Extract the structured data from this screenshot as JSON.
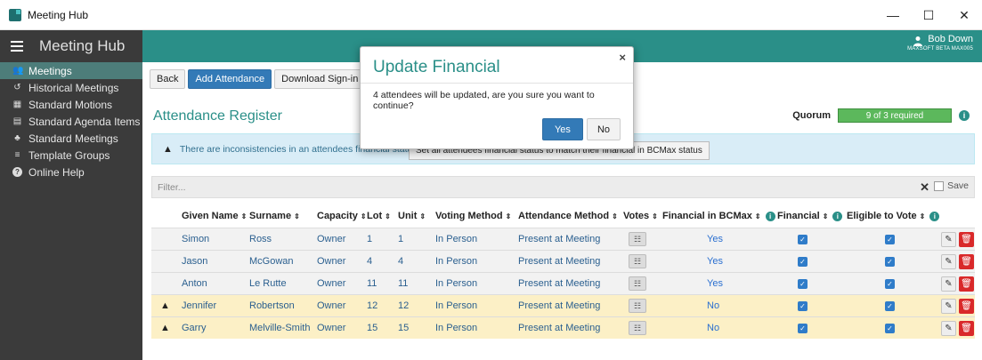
{
  "window": {
    "title": "Meeting Hub",
    "minimize": "—",
    "maximize": "☐",
    "close": "✕"
  },
  "header": {
    "brand": "Meeting Hub",
    "user_name": "Bob Down",
    "user_sub": "MAXSOFT BETA MAX005"
  },
  "sidebar": {
    "items": [
      {
        "label": "Meetings",
        "icon": "👥",
        "active": true
      },
      {
        "label": "Historical Meetings",
        "icon": "↺"
      },
      {
        "label": "Standard Motions",
        "icon": "▦"
      },
      {
        "label": "Standard Agenda Items",
        "icon": "▤"
      },
      {
        "label": "Standard Meetings",
        "icon": "♣"
      },
      {
        "label": "Template Groups",
        "icon": "≡"
      },
      {
        "label": "Online Help",
        "icon": "?"
      }
    ]
  },
  "toolbar": {
    "back": "Back",
    "add_attendance": "Add Attendance",
    "download_sign_in": "Download Sign-in Sheet"
  },
  "page": {
    "title": "Attendance Register",
    "quorum_label": "Quorum",
    "quorum_value": "9 of 3 required"
  },
  "alert": {
    "text": "There are inconsistencies in an attendees financial status",
    "button": "Set all attendees financial status to match their financial in BCMax status"
  },
  "filter": {
    "placeholder": "Filter...",
    "clear": "✕",
    "save_label": "Save"
  },
  "table": {
    "headers": {
      "given": "Given Name",
      "surname": "Surname",
      "capacity": "Capacity",
      "lot": "Lot",
      "unit": "Unit",
      "voting_method": "Voting Method",
      "attendance_method": "Attendance Method",
      "votes": "Votes",
      "financial_bcmax": "Financial in BCMax",
      "financial": "Financial",
      "eligible": "Eligible to Vote"
    },
    "sort_icon": "⇕",
    "rows": [
      {
        "warn": false,
        "given": "Simon",
        "surname": "Ross",
        "capacity": "Owner",
        "lot": "1",
        "unit": "1",
        "voting_method": "In Person",
        "attendance_method": "Present at Meeting",
        "financial_bcmax": "Yes",
        "financial": true,
        "eligible": true
      },
      {
        "warn": false,
        "given": "Jason",
        "surname": "McGowan",
        "capacity": "Owner",
        "lot": "4",
        "unit": "4",
        "voting_method": "In Person",
        "attendance_method": "Present at Meeting",
        "financial_bcmax": "Yes",
        "financial": true,
        "eligible": true
      },
      {
        "warn": false,
        "given": "Anton",
        "surname": "Le Rutte",
        "capacity": "Owner",
        "lot": "11",
        "unit": "11",
        "voting_method": "In Person",
        "attendance_method": "Present at Meeting",
        "financial_bcmax": "Yes",
        "financial": true,
        "eligible": true
      },
      {
        "warn": true,
        "given": "Jennifer",
        "surname": "Robertson",
        "capacity": "Owner",
        "lot": "12",
        "unit": "12",
        "voting_method": "In Person",
        "attendance_method": "Present at Meeting",
        "financial_bcmax": "No",
        "financial": true,
        "eligible": true
      },
      {
        "warn": true,
        "given": "Garry",
        "surname": "Melville-Smith",
        "capacity": "Owner",
        "lot": "15",
        "unit": "15",
        "voting_method": "In Person",
        "attendance_method": "Present at Meeting",
        "financial_bcmax": "No",
        "financial": true,
        "eligible": true
      }
    ]
  },
  "modal": {
    "title": "Update Financial",
    "message": "4 attendees will be updated, are you sure you want to continue?",
    "yes": "Yes",
    "no": "No",
    "close": "×"
  },
  "colors": {
    "brand": "#2a8f88",
    "primary": "#337ab7",
    "quorum": "#5cb85c",
    "danger": "#d9292a",
    "warn_row": "#fcf0c6"
  }
}
